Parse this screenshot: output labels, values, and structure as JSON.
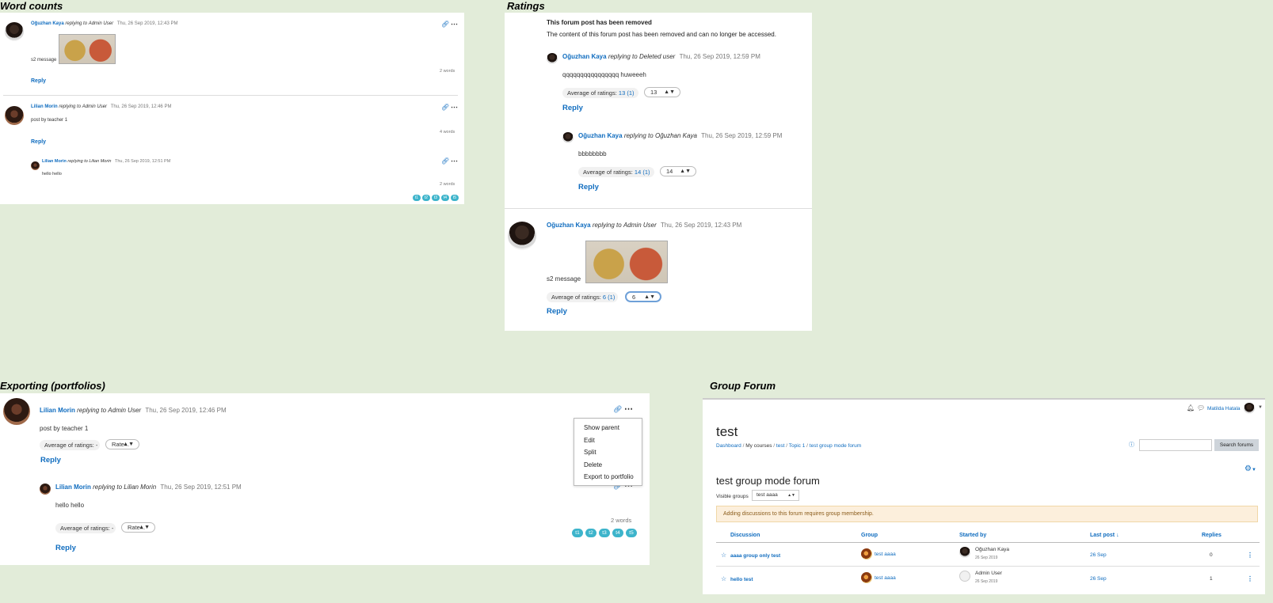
{
  "sections": {
    "word_counts": "Word counts",
    "ratings": "Ratings",
    "exporting": "Exporting (portfolios)",
    "group_forum": "Group Forum"
  },
  "word_counts": {
    "post1": {
      "author": "Oğuzhan Kaya",
      "replying": "replying to",
      "target": "Admin User",
      "date": "Thu, 26 Sep 2019, 12:43 PM",
      "message": "s2 message",
      "words": "2 words",
      "reply": "Reply"
    },
    "post2": {
      "author": "Lilian Morin",
      "replying": "replying to",
      "target": "Admin User",
      "date": "Thu, 26 Sep 2019, 12:46 PM",
      "message": "post by teacher 1",
      "words": "4 words",
      "reply": "Reply"
    },
    "post3": {
      "author": "Lilian Morin",
      "replying": "replying to",
      "target": "Lilian Morin",
      "date": "Thu, 26 Sep 2019, 12:51 PM",
      "message": "hello hello",
      "words": "2 words"
    },
    "tags": [
      "t1",
      "t2",
      "t3",
      "t4",
      "t5"
    ]
  },
  "ratings": {
    "removed_title": "This forum post has been removed",
    "removed_body": "The content of this forum post has been removed and can no longer be accessed.",
    "post1": {
      "author": "Oğuzhan Kaya",
      "replying": "replying to",
      "target": "Deleted user",
      "date": "Thu, 26 Sep 2019, 12:59 PM",
      "message": "qqqqqqqqqqqqqqqq huweeeh",
      "avg_label": "Average of ratings:",
      "avg_value": "13 (1)",
      "select": "13",
      "reply": "Reply"
    },
    "post2": {
      "author": "Oğuzhan Kaya",
      "replying": "replying to",
      "target": "Oğuzhan Kaya",
      "date": "Thu, 26 Sep 2019, 12:59 PM",
      "message": "bbbbbbbb",
      "avg_label": "Average of ratings:",
      "avg_value": "14 (1)",
      "select": "14",
      "reply": "Reply"
    },
    "post3": {
      "author": "Oğuzhan Kaya",
      "replying": "replying to",
      "target": "Admin User",
      "date": "Thu, 26 Sep 2019, 12:43 PM",
      "message": "s2 message",
      "avg_label": "Average of ratings:",
      "avg_value": "6 (1)",
      "select": "6",
      "reply": "Reply"
    }
  },
  "exporting": {
    "post1": {
      "author": "Lilian Morin",
      "replying": "replying to",
      "target": "Admin User",
      "date": "Thu, 26 Sep 2019, 12:46 PM",
      "message": "post by teacher 1",
      "avg_label": "Average of ratings: -",
      "select": "Rate...",
      "reply": "Reply"
    },
    "post2": {
      "author": "Lilian Morin",
      "replying": "replying to",
      "target": "Lilian Morin",
      "date": "Thu, 26 Sep 2019, 12:51 PM",
      "message": "hello hello",
      "avg_label": "Average of ratings: -",
      "select": "Rate...",
      "words": "2 words",
      "reply": "Reply"
    },
    "menu": [
      "Show parent",
      "Edit",
      "Split",
      "Delete",
      "Export to portfolio"
    ],
    "tags": [
      "t1",
      "t2",
      "t3",
      "t4",
      "t5"
    ]
  },
  "group_forum": {
    "user": "Matilda Hatala",
    "course_title": "test",
    "breadcrumb": [
      "Dashboard",
      "My courses",
      "test",
      "Topic 1",
      "test group mode forum"
    ],
    "search_button": "Search forums",
    "search_placeholder": "",
    "forum_title": "test group mode forum",
    "visible_groups_label": "Visible groups",
    "visible_groups_value": "test aaaa",
    "notice": "Adding discussions to this forum requires group membership.",
    "columns": [
      "Discussion",
      "Group",
      "Started by",
      "Last post",
      "Replies"
    ],
    "rows": [
      {
        "discussion": "aaaa group only test",
        "group": "test aaaa",
        "starter": "Oğuzhan Kaya",
        "start_date": "26 Sep 2019",
        "last_post": "26 Sep",
        "replies": "0"
      },
      {
        "discussion": "hello test",
        "group": "test aaaa",
        "starter": "Admin User",
        "start_date": "26 Sep 2019",
        "last_post": "26 Sep",
        "replies": "1"
      }
    ]
  },
  "colors": {
    "link": "#0f6cbf",
    "tag": "#3db4cb",
    "background": "#e2ecd9"
  }
}
